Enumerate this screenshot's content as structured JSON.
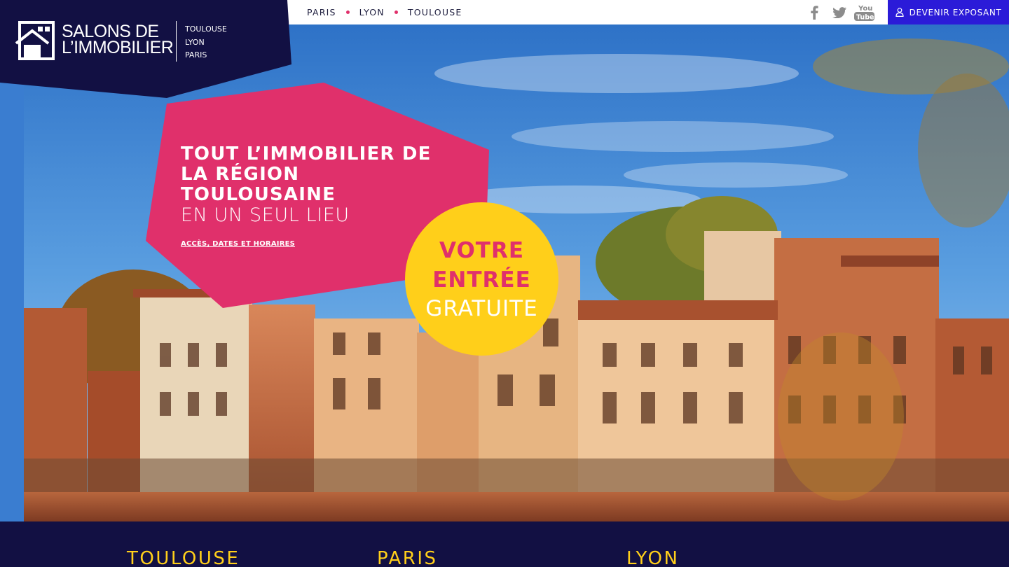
{
  "brand": {
    "name_line1": "SALONS DE",
    "name_line2": "L’IMMOBILIER",
    "cities": [
      "TOULOUSE",
      "LYON",
      "PARIS"
    ],
    "colors": {
      "navy": "#121043",
      "pink": "#e0306b",
      "yellow": "#ffcf1a",
      "blue_button": "#2b1bd8"
    }
  },
  "nav": {
    "cities": [
      "PARIS",
      "LYON",
      "TOULOUSE"
    ],
    "social": [
      "facebook-icon",
      "twitter-icon",
      "youtube-icon"
    ],
    "youtube_label_1": "You",
    "youtube_label_2": "Tube",
    "exposant_label": "DEVENIR EXPOSANT"
  },
  "hero": {
    "headline_line1": "TOUT L’IMMOBILIER DE",
    "headline_line2": "LA RÉGION",
    "headline_line3": "TOULOUSAINE",
    "subheadline": "EN UN SEUL LIEU",
    "link_label": "ACCÈS, DATES ET HORAIRES",
    "badge_line1": "VOTRE",
    "badge_line2": "ENTRÉE",
    "badge_line3": "GRATUITE"
  },
  "footer_band": {
    "cities": [
      "TOULOUSE",
      "PARIS",
      "LYON"
    ]
  }
}
